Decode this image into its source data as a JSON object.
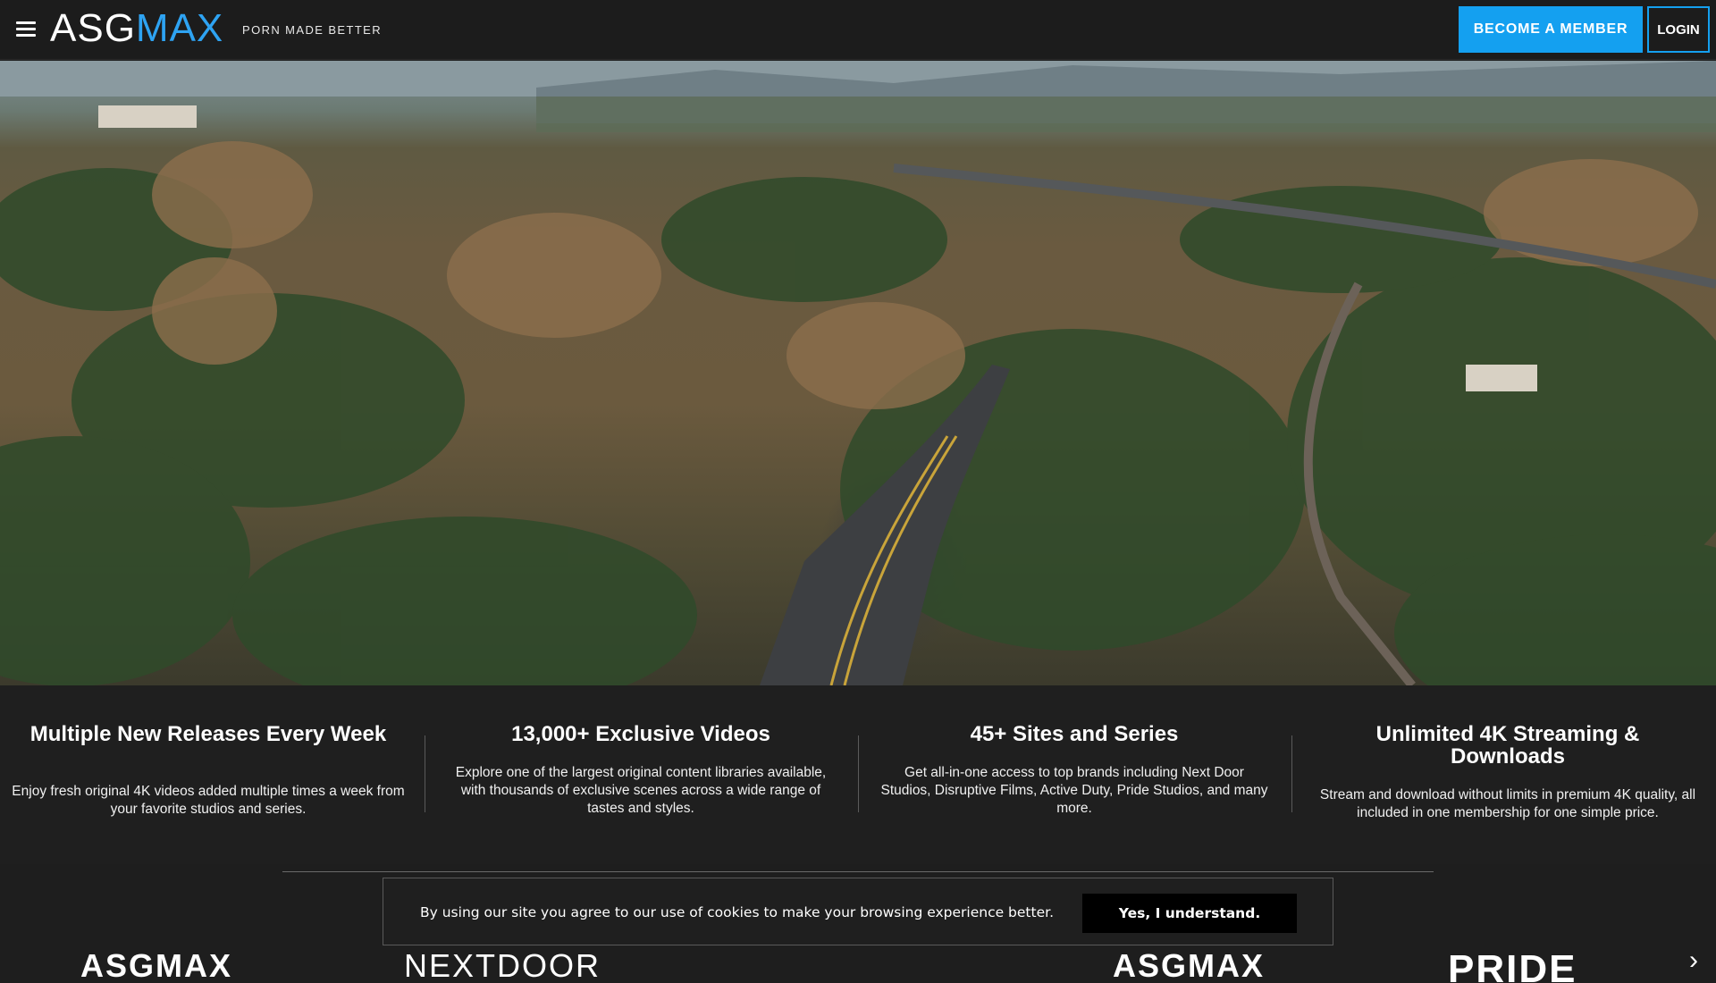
{
  "header": {
    "logo_left": "ASG",
    "logo_right": "MAX",
    "tagline": "PORN MADE BETTER",
    "member_button": "BECOME A MEMBER",
    "login_button": "LOGIN"
  },
  "features": [
    {
      "title": "Multiple New Releases Every Week",
      "text": "Enjoy fresh original 4K videos added multiple times a week from your favorite studios and series."
    },
    {
      "title": "13,000+ Exclusive Videos",
      "text": "Explore one of the largest original content libraries available, with thousands of exclusive scenes across a wide range of tastes and styles."
    },
    {
      "title": "45+ Sites and Series",
      "text": "Get all-in-one access to top brands including Next Door Studios, Disruptive Films, Active Duty, Pride Studios, and many more."
    },
    {
      "title": "Unlimited 4K Streaming & Downloads",
      "text": "Stream and download without limits in premium 4K quality, all included in one membership for one simple price."
    }
  ],
  "brands": [
    "ASGMAX",
    "NEXTDOOR",
    "ASGMAX",
    "PRIDE"
  ],
  "cookie": {
    "text": "By using our site you agree to our use of cookies to make your browsing experience better.",
    "button": "Yes, I understand."
  },
  "colors": {
    "accent": "#14a0f0",
    "background": "#1f1f1f"
  }
}
